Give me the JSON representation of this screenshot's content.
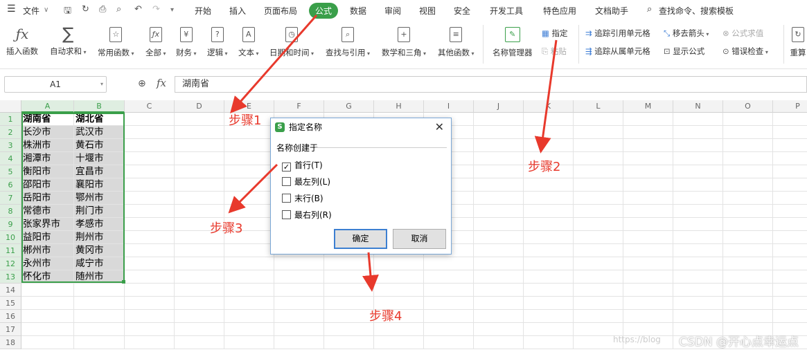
{
  "menu": {
    "file": "文件",
    "tabs": [
      "开始",
      "插入",
      "页面布局",
      "公式",
      "数据",
      "审阅",
      "视图",
      "安全",
      "开发工具",
      "特色应用",
      "文档助手"
    ],
    "active_tab": "公式",
    "search": "查找命令、搜索模板"
  },
  "ribbon": {
    "buttons": [
      {
        "label": "插入函数",
        "icon": "fx-icon",
        "glyph": "ƒx"
      },
      {
        "label": "自动求和",
        "icon": "sum-icon",
        "glyph": "∑"
      },
      {
        "label": "常用函数",
        "icon": "function-book-icon",
        "glyph": "☆"
      },
      {
        "label": "全部",
        "icon": "all-functions-icon",
        "glyph": "ƒx"
      },
      {
        "label": "财务",
        "icon": "finance-icon",
        "glyph": "¥"
      },
      {
        "label": "逻辑",
        "icon": "logic-icon",
        "glyph": "?"
      },
      {
        "label": "文本",
        "icon": "text-icon",
        "glyph": "A"
      },
      {
        "label": "日期和时间",
        "icon": "clock-icon",
        "glyph": "◷"
      },
      {
        "label": "查找与引用",
        "icon": "lookup-icon",
        "glyph": "⌕"
      },
      {
        "label": "数学和三角",
        "icon": "math-icon",
        "glyph": "+"
      },
      {
        "label": "其他函数",
        "icon": "other-functions-icon",
        "glyph": "≡"
      },
      {
        "label": "名称管理器",
        "icon": "name-manager-icon",
        "glyph": "✎"
      }
    ],
    "specify": "指定",
    "paste": "粘贴",
    "trace_precedents": "追踪引用单元格",
    "trace_dependents": "追踪从属单元格",
    "remove_arrows": "移去箭头",
    "show_formulas": "显示公式",
    "evaluate_formula": "公式求值",
    "error_checking": "错误检查",
    "recalc": "重算"
  },
  "formula_bar": {
    "cell_ref": "A1",
    "fx": "fx",
    "value": "湖南省"
  },
  "columns": [
    "A",
    "B",
    "C",
    "D",
    "E",
    "F",
    "G",
    "H",
    "I",
    "J",
    "K",
    "L",
    "M",
    "N",
    "O",
    "P"
  ],
  "rows": [
    "1",
    "2",
    "3",
    "4",
    "5",
    "6",
    "7",
    "8",
    "9",
    "10",
    "11",
    "12",
    "13",
    "14",
    "15",
    "16",
    "17",
    "18"
  ],
  "data": [
    [
      "湖南省",
      "湖北省"
    ],
    [
      "长沙市",
      "武汉市"
    ],
    [
      "株洲市",
      "黄石市"
    ],
    [
      "湘潭市",
      "十堰市"
    ],
    [
      "衡阳市",
      "宜昌市"
    ],
    [
      "邵阳市",
      "襄阳市"
    ],
    [
      "岳阳市",
      "鄂州市"
    ],
    [
      "常德市",
      "荆门市"
    ],
    [
      "张家界市",
      "孝感市"
    ],
    [
      "益阳市",
      "荆州市"
    ],
    [
      "郴州市",
      "黄冈市"
    ],
    [
      "永州市",
      "咸宁市"
    ],
    [
      "怀化市",
      "随州市"
    ]
  ],
  "dialog": {
    "title": "指定名称",
    "group": "名称创建于",
    "options": [
      {
        "label": "首行(T)",
        "checked": true
      },
      {
        "label": "最左列(L)",
        "checked": false
      },
      {
        "label": "末行(B)",
        "checked": false
      },
      {
        "label": "最右列(R)",
        "checked": false
      }
    ],
    "ok": "确定",
    "cancel": "取消"
  },
  "annotations": [
    "步骤1",
    "步骤2",
    "步骤3",
    "步骤4"
  ],
  "watermark": "CSDN @开心点幸运点",
  "watermark_url": "https://blog",
  "colors": {
    "accent": "#3a9f4a",
    "arrow": "#e8392c",
    "dialog_border": "#7aa7d6"
  }
}
